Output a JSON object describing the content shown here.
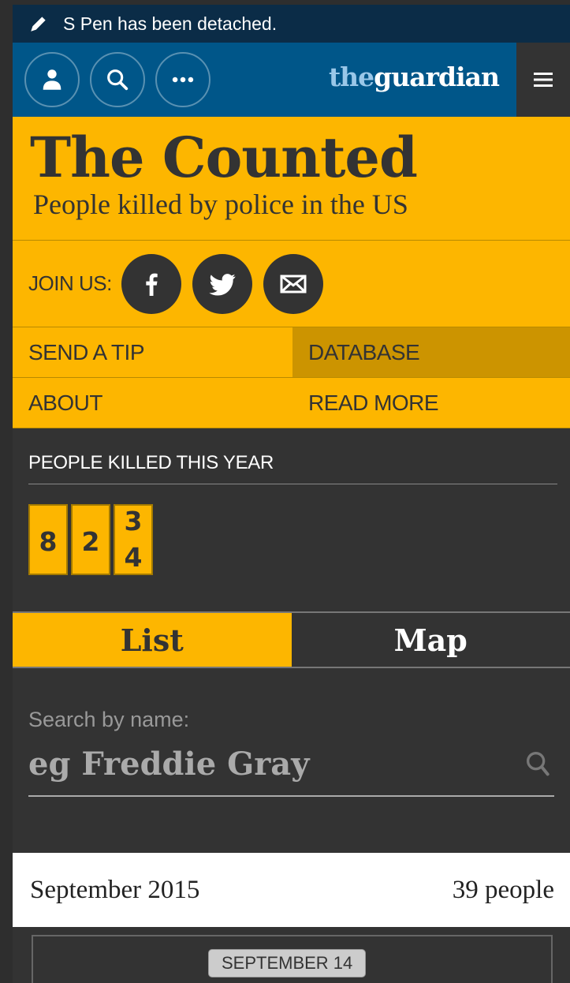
{
  "statusbar": {
    "message": "S Pen has been detached."
  },
  "header": {
    "logo_the": "the",
    "logo_guardian": "guardian"
  },
  "hero": {
    "title": "The Counted",
    "subtitle": "People killed by police in the US"
  },
  "join": {
    "label": "JOIN US:"
  },
  "nav": {
    "send_tip": "SEND A TIP",
    "database": "DATABASE",
    "about": "ABOUT",
    "read_more": "READ MORE"
  },
  "counter": {
    "title": "PEOPLE KILLED THIS YEAR",
    "digits": [
      "8",
      "2",
      "3"
    ],
    "rolling_next": "4"
  },
  "tabs": {
    "list": "List",
    "map": "Map"
  },
  "search": {
    "label": "Search by name:",
    "placeholder": "eg Freddie Gray"
  },
  "month": {
    "name": "September 2015",
    "count": "39 people"
  },
  "day": {
    "label": "SEPTEMBER 14"
  },
  "colors": {
    "guardian_blue": "#005689",
    "counted_yellow": "#fdb600",
    "dark": "#333333"
  }
}
